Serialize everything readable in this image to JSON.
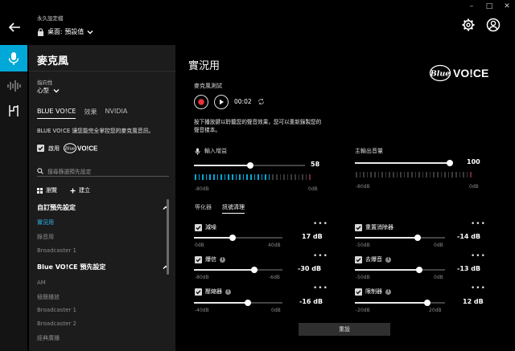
{
  "header": {
    "profile_caption": "永久設定檔",
    "profile_name": "桌面: 預設值"
  },
  "sidebar_panel": {
    "title": "麥克風",
    "polar_label": "指向性",
    "polar_value": "心型",
    "tabs": [
      "BLUE VO!CE",
      "效果",
      "NVIDIA"
    ],
    "description": "BLUE VO!CE 讓您能完全掌控您的麥克風音訊。",
    "enable_label": "啟用",
    "search_placeholder": "搜尋篩選預先設定",
    "browse_label": "瀏覽",
    "create_label": "建立",
    "custom_section": "自訂預先設定",
    "custom_presets": [
      "實況用",
      "錄音用",
      "Broadcaster 1"
    ],
    "blue_section": "Blue VO!CE 預先設定",
    "blue_presets": [
      "AM",
      "極簡播放",
      "Broadcaster 1",
      "Broadcaster 2",
      "經典廣播"
    ]
  },
  "main": {
    "title": "實況用",
    "mic_test_label": "麥克風測試",
    "timer": "00:02",
    "test_hint_line1": "按下播放鍵以聆聽您的聲音效果，您可以重新錄製您的",
    "test_hint_line2": "聲音樣本。",
    "input_gain_label": "輸入增益",
    "input_gain_value": "58",
    "input_min": "-80dB",
    "input_max": "0dB",
    "output_label": "主輸出音量",
    "output_value": "100",
    "output_min": "-80dB",
    "output_max": "0dB",
    "subtabs": [
      "等化器",
      "訊號清理"
    ],
    "effects": {
      "noise_reduction": {
        "name": "減噪",
        "value": "17 dB",
        "min": "0dB",
        "max": "40dB"
      },
      "deesser": {
        "name": "爆信",
        "value": "-30 dB",
        "min": "-80dB",
        "max": "-6dB"
      },
      "compressor": {
        "name": "壓縮器",
        "value": "-16 dB",
        "min": "-40dB",
        "max": "0dB"
      },
      "expander": {
        "name": "重置消除器",
        "value": "-14 dB",
        "min": "-50dB",
        "max": "0dB"
      },
      "declicker": {
        "name": "去爆音",
        "value": "-13 dB",
        "min": "-50dB",
        "max": "0dB"
      },
      "limiter": {
        "name": "限制器",
        "value": "12 dB",
        "min": "-20dB",
        "max": "20dB"
      }
    },
    "reset_label": "重設"
  },
  "colors": {
    "accent": "#00a8d8",
    "record": "#e8313a",
    "panel": "#1c1c1c"
  }
}
